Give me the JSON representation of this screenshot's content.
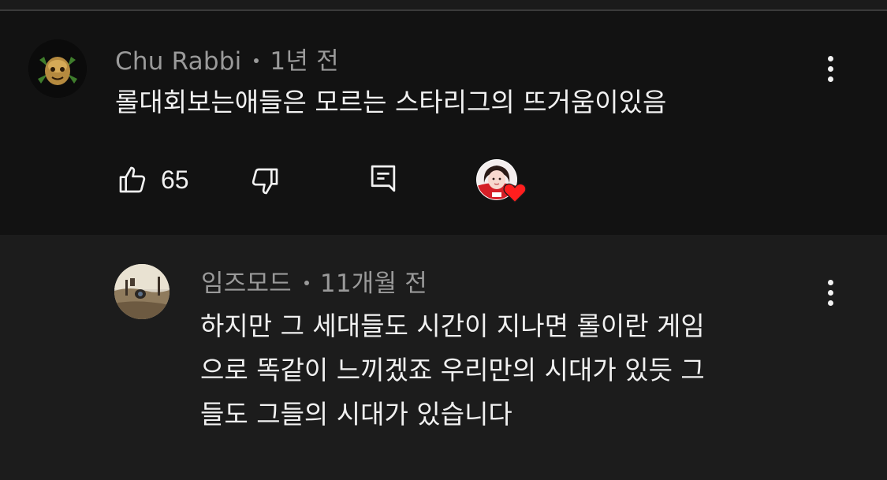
{
  "comments": [
    {
      "author": "Chu Rabbi",
      "time": "1년 전",
      "text": "롤대회보는애들은 모르는 스타리그의 뜨거움이있음",
      "likes": "65",
      "avatar_icon": "green-creature-avatar",
      "hearted": true
    },
    {
      "author": "임즈모드",
      "time": "11개월 전",
      "text_lines": [
        "하지만 그 세대들도 시간이 지나면 롤이란 게임",
        "으로 똑같이 느끼겠죠 우리만의 시대가 있듯 그",
        "들도 그들의 시대가 있습니다"
      ],
      "avatar_icon": "landscape-photo-avatar"
    }
  ],
  "icons": {
    "like": "thumbs-up-icon",
    "dislike": "thumbs-down-icon",
    "reply": "reply-comment-icon",
    "more": "more-vertical-icon",
    "heart": "creator-heart-icon"
  },
  "colors": {
    "background": "#0f0f0f",
    "main_comment_bg": "#121212",
    "reply_bg": "#1c1c1c",
    "meta_text": "#9a9a9a",
    "body_text": "#f1f1f1",
    "heart": "#ff1e1e"
  }
}
